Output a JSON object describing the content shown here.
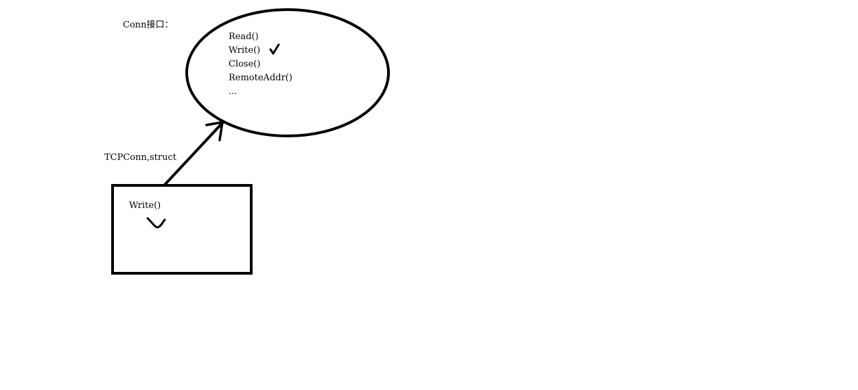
{
  "colors": {
    "background": "#ffffff",
    "ink": "#000000"
  },
  "interface": {
    "title": "Conn接口：",
    "methods": [
      "Read()",
      "Write()",
      "Close()",
      "RemoteAddr()",
      "..."
    ],
    "checked_method_index": 1
  },
  "arrow": {
    "label": "TCPConn,struct"
  },
  "struct": {
    "method": "Write()",
    "mark_icon": "smile-curve-icon"
  }
}
